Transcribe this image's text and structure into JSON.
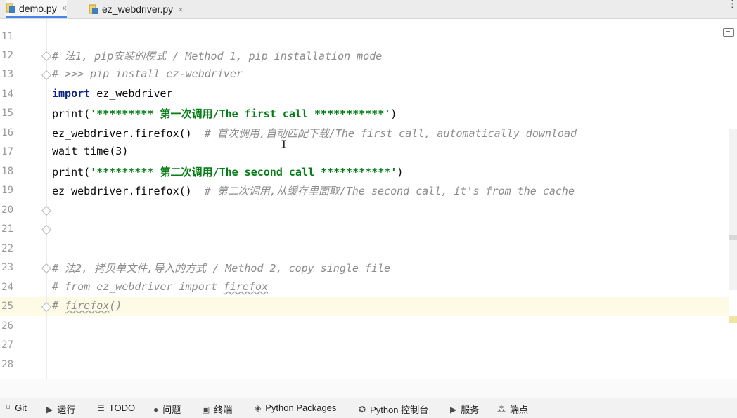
{
  "tabs": [
    {
      "label": "demo.py",
      "active": true
    },
    {
      "label": "ez_webdriver.py",
      "active": false
    }
  ],
  "icons": {
    "tab_close": "×",
    "kebab": "⋮"
  },
  "lines": [
    {
      "n": "11"
    },
    {
      "n": "12"
    },
    {
      "n": "13"
    },
    {
      "n": "14"
    },
    {
      "n": "15"
    },
    {
      "n": "16"
    },
    {
      "n": "17"
    },
    {
      "n": "18"
    },
    {
      "n": "19"
    },
    {
      "n": "20"
    },
    {
      "n": "21"
    },
    {
      "n": "22"
    },
    {
      "n": "23"
    },
    {
      "n": "24"
    },
    {
      "n": "25"
    },
    {
      "n": "26"
    },
    {
      "n": "27"
    },
    {
      "n": "28"
    }
  ],
  "code": {
    "l12_comment": "# 法1, pip安装的模式 / Method 1, pip installation mode",
    "l13_comment": "# >>> pip install ez-webdriver",
    "l14_kw": "import",
    "l14_rest": " ez_webdriver",
    "l15_call": "print(",
    "l15_str": "'********* 第一次调用/The first call ***********'",
    "l15_end": ")",
    "l16_code": "ez_webdriver.firefox()  ",
    "l16_comment": "# 首次调用,自动匹配下载/The first call, automatically download",
    "l17_code": "wait_time(3)",
    "l18_call": "print(",
    "l18_str": "'********* 第二次调用/The second call ***********'",
    "l18_end": ")",
    "l19_code": "ez_webdriver.firefox()  ",
    "l19_comment": "# 第二次调用,从缓存里面取/The second call, it's from the cache",
    "l23_comment": "# 法2, 拷贝单文件,导入的方式 / Method 2, copy single file",
    "l24_pre": "# from ez_webdriver import ",
    "l24_u": "firefox",
    "l25_pre": "# ",
    "l25_u": "firefox",
    "l25_end": "()"
  },
  "bottombar": [
    {
      "label": "Git",
      "icon": "branch-icon"
    },
    {
      "label": "运行",
      "icon": "run-icon"
    },
    {
      "label": "TODO",
      "icon": "list-icon"
    },
    {
      "label": "问题",
      "icon": "problems-icon"
    },
    {
      "label": "终端",
      "icon": "terminal-icon"
    },
    {
      "label": "Python Packages",
      "icon": "layers-icon"
    },
    {
      "label": "Python 控制台",
      "icon": "python-icon"
    },
    {
      "label": "服务",
      "icon": "services-icon"
    },
    {
      "label": "端点",
      "icon": "endpoints-icon"
    }
  ],
  "colors": {
    "current_line": "#fdfbe6",
    "string": "#067d17",
    "keyword": "#0a2680",
    "comment": "#8c8c8c"
  }
}
